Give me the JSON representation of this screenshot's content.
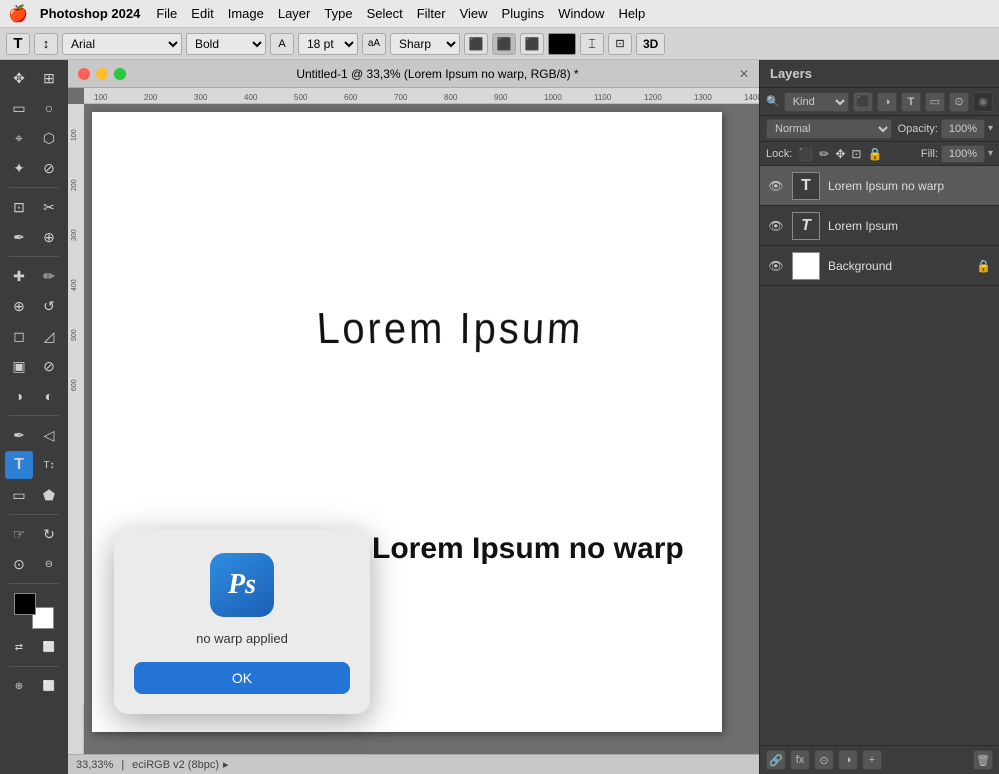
{
  "menubar": {
    "apple": "🍎",
    "app_name": "Photoshop 2024",
    "menus": [
      "File",
      "Edit",
      "Image",
      "Layer",
      "Type",
      "Select",
      "Filter",
      "View",
      "Plugins",
      "Window",
      "Help"
    ]
  },
  "optionsbar": {
    "tool_icon": "T",
    "orient_icon": "↕",
    "font_family": "Arial",
    "font_style": "Bold",
    "size_icon": "A",
    "font_size": "18 pt",
    "aa_icon": "aA",
    "anti_alias": "Sharp",
    "align_left": "≡",
    "align_center": "≡",
    "align_right": "≡",
    "color_swatch": "■",
    "baseline": "⌶",
    "warp": "⊡",
    "three_d": "3D"
  },
  "canvas": {
    "title": "Untitled-1 @ 33,3% (Lorem Ipsum no warp, RGB/8) *",
    "warped_text": "Lorem Ipsum",
    "nowarp_text": "Lorem Ipsum no warp",
    "zoom": "33,33%",
    "colorspace": "eciRGB v2 (8bpc)"
  },
  "dialog": {
    "icon_letter": "Ps",
    "message": "no warp applied",
    "ok_label": "OK"
  },
  "layers": {
    "panel_title": "Layers",
    "filter_label": "Kind",
    "blend_mode": "Normal",
    "opacity_label": "Opacity:",
    "opacity_value": "100%",
    "lock_label": "Lock:",
    "fill_label": "Fill:",
    "fill_value": "100%",
    "items": [
      {
        "name": "Lorem Ipsum no warp",
        "type": "text",
        "visible": true,
        "selected": true,
        "locked": false,
        "thumb_letter": "T"
      },
      {
        "name": "Lorem Ipsum",
        "type": "text",
        "visible": true,
        "selected": false,
        "locked": false,
        "thumb_letter": "T"
      },
      {
        "name": "Background",
        "type": "bg",
        "visible": true,
        "selected": false,
        "locked": true,
        "thumb_letter": ""
      }
    ]
  },
  "toolbar": {
    "tools": [
      {
        "id": "move",
        "icon": "✥",
        "active": false
      },
      {
        "id": "select-rect",
        "icon": "▭",
        "active": false
      },
      {
        "id": "lasso",
        "icon": "⌖",
        "active": false
      },
      {
        "id": "magic-wand",
        "icon": "✦",
        "active": false
      },
      {
        "id": "crop",
        "icon": "⊡",
        "active": false
      },
      {
        "id": "eyedropper",
        "icon": "⊘",
        "active": false
      },
      {
        "id": "heal",
        "icon": "✚",
        "active": false
      },
      {
        "id": "brush",
        "icon": "✏",
        "active": false
      },
      {
        "id": "clone",
        "icon": "⊕",
        "active": false
      },
      {
        "id": "eraser",
        "icon": "◻",
        "active": false
      },
      {
        "id": "gradient",
        "icon": "▣",
        "active": false
      },
      {
        "id": "dodge",
        "icon": "◑",
        "active": false
      },
      {
        "id": "pen",
        "icon": "✒",
        "active": false
      },
      {
        "id": "text",
        "icon": "T",
        "active": true
      },
      {
        "id": "hand",
        "icon": "☞",
        "active": false
      },
      {
        "id": "zoom",
        "icon": "⊙",
        "active": false
      }
    ]
  },
  "statusbar": {
    "zoom": "33,33%",
    "colorspace": "eciRGB v2 (8bpc)"
  }
}
